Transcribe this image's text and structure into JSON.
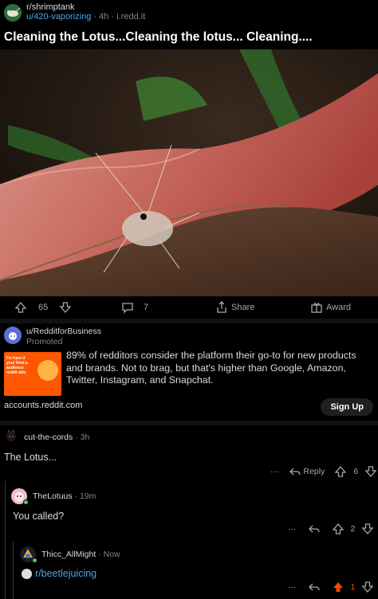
{
  "post": {
    "subreddit": "r/shrimptank",
    "author": "u/420-vaporizing",
    "age": "4h",
    "domain": "i.redd.it",
    "title": "Cleaning the Lotus...Cleaning the lotus... Cleaning....",
    "image_alt": "shrimp on red lotus leaf"
  },
  "actions": {
    "score": "65",
    "comments": "7",
    "share_label": "Share",
    "award_label": "Award"
  },
  "ad": {
    "user": "u/RedditforBusiness",
    "promoted_label": "Promoted",
    "thumb_text": "I'm here if you! Find a audience reddit ads.",
    "body": "89% of redditors consider the platform their go-to for new products and brands. Not to brag, but that's higher than Google, Amazon, Twitter, Instagram, and Snapchat.",
    "domain": "accounts.reddit.com",
    "cta": "Sign Up"
  },
  "comments": [
    {
      "user": "cut-the-cords",
      "age": "3h",
      "body": "The Lotus...",
      "reply_label": "Reply",
      "score": "6"
    },
    {
      "user": "TheLotuus",
      "age": "19m",
      "body": "You called?",
      "score": "2"
    },
    {
      "user": "Thicc_AllMight",
      "age": "Now",
      "body": "r/beetlejuicing",
      "score": "1"
    }
  ],
  "colors": {
    "background": "#000000",
    "link": "#4fa3e3",
    "upvoted": "#ff4500",
    "ad_thumb": "#ff5700"
  }
}
